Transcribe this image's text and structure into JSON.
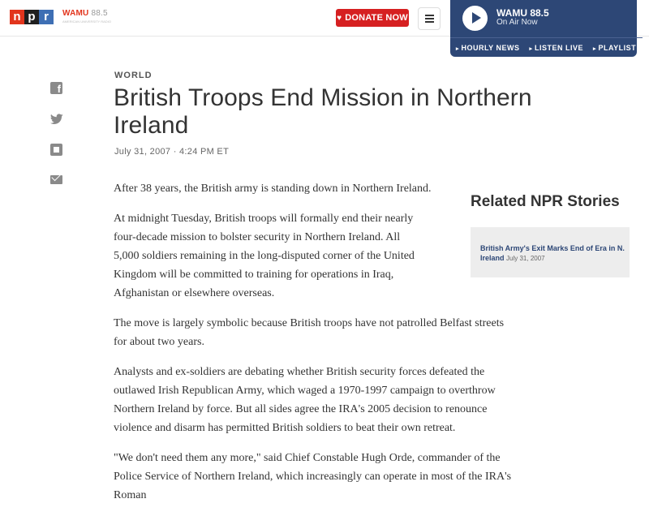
{
  "header": {
    "npr_letters": [
      "n",
      "p",
      "r"
    ],
    "station_name": "WAMU",
    "station_freq": "88.5",
    "station_tagline": "AMERICAN UNIVERSITY RADIO",
    "donate_label": "DONATE NOW",
    "menu_icon": "hamburger-icon"
  },
  "player": {
    "station": "WAMU 88.5",
    "status": "On Air Now",
    "links": [
      "HOURLY NEWS",
      "LISTEN LIVE",
      "PLAYLIST"
    ]
  },
  "social": [
    "facebook-icon",
    "twitter-icon",
    "flipboard-icon",
    "email-icon"
  ],
  "article": {
    "slug": "WORLD",
    "headline": "British Troops End Mission in Northern Ireland",
    "date": "July 31, 2007 · 4:24 PM ET",
    "paragraphs": [
      "After 38 years, the British army is standing down in Northern Ireland.",
      "At midnight Tuesday, British troops will formally end their nearly four-decade mission to bolster security in Northern Ireland. All 5,000 soldiers remaining in the long-disputed corner of the United Kingdom will be committed to training for operations in Iraq, Afghanistan or elsewhere overseas.",
      "The move is largely symbolic because British troops have not patrolled Belfast streets for about two years.",
      "Analysts and ex-soldiers are debating whether British security forces defeated the outlawed Irish Republican Army, which waged a 1970-1997 campaign to overthrow Northern Ireland by force. But all sides agree the IRA's 2005 decision to renounce violence and disarm has permitted British soldiers to beat their own retreat.",
      "\"We don't need them any more,\" said Chief Constable Hugh Orde, commander of the Police Service of Northern Ireland, which increasingly can operate in most of the IRA's Roman"
    ]
  },
  "related": {
    "title": "Related NPR Stories",
    "story_title": "British Army's Exit Marks End of Era in N. Ireland",
    "story_date": "July 31, 2007"
  },
  "colors": {
    "npr_red": "#e2351d",
    "npr_black": "#1f1f1f",
    "npr_blue": "#3e6fb4",
    "donate": "#d62021",
    "player_bg": "#2d4776"
  }
}
